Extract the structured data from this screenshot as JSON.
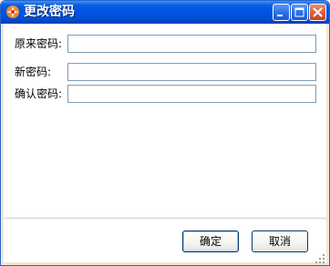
{
  "window": {
    "title": "更改密码"
  },
  "form": {
    "old_password_label": "原来密码:",
    "old_password_value": "",
    "new_password_label": "新密码:",
    "new_password_value": "",
    "confirm_password_label": "确认密码:",
    "confirm_password_value": ""
  },
  "buttons": {
    "ok_label": "确定",
    "cancel_label": "取消"
  },
  "icons": {
    "app": "app-logo-icon",
    "minimize": "minimize-icon",
    "maximize": "maximize-icon",
    "close": "close-icon",
    "resize": "resize-grip-icon"
  },
  "colors": {
    "titlebar": "#0054e3",
    "title_text": "#ffffff",
    "input_border": "#7f9db9",
    "button_border": "#003c74",
    "close_button": "#e05d3a"
  }
}
